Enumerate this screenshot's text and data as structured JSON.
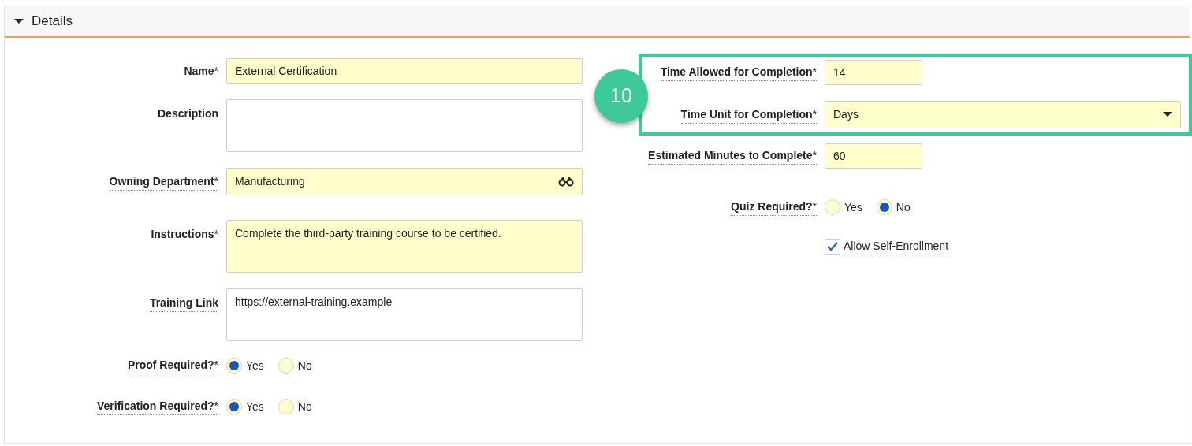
{
  "section": {
    "title": "Details",
    "expanded": true
  },
  "left_fields": [
    {
      "kind": "text",
      "label": "Name",
      "required_mark": "*",
      "required": true,
      "help": false,
      "value": "External Certification"
    },
    {
      "kind": "textarea",
      "label": "Description",
      "required": false,
      "help": false
    },
    {
      "kind": "lookup",
      "label": "Owning Department",
      "required_mark": "*",
      "required": true,
      "help": true,
      "value": "Manufacturing"
    },
    {
      "kind": "textarea",
      "label": "Instructions",
      "required_mark": "*",
      "required": true,
      "help": false,
      "value": "Complete the third-party training course to be certified."
    },
    {
      "kind": "textarea",
      "label": "Training Link",
      "required": false,
      "help": true,
      "value": "https://external-training.example"
    },
    {
      "kind": "radio",
      "label": "Proof Required?",
      "required_mark": "*",
      "required": true,
      "help": true,
      "options": [
        {
          "label": "Yes",
          "selected": true
        },
        {
          "label": "No",
          "selected": false
        }
      ]
    },
    {
      "kind": "radio",
      "label": "Verification Required?",
      "required_mark": "*",
      "required": true,
      "help": true,
      "options": [
        {
          "label": "Yes",
          "selected": true
        },
        {
          "label": "No",
          "selected": false
        }
      ]
    }
  ],
  "highlight": {
    "badge": "10",
    "fields": [
      {
        "kind": "short",
        "label": "Time Allowed for Completion",
        "required_mark": "*",
        "required": true,
        "help": true,
        "value": "14"
      },
      {
        "kind": "select",
        "label": "Time Unit for Completion",
        "required_mark": "*",
        "required": true,
        "help": true,
        "value": "Days"
      }
    ]
  },
  "right_fields": [
    {
      "kind": "short",
      "label": "Estimated Minutes to Complete",
      "required_mark": "*",
      "required": true,
      "help": true,
      "value": "60"
    },
    {
      "kind": "radio",
      "label": "Quiz Required?",
      "required_mark": "*",
      "required": true,
      "help": true,
      "options": [
        {
          "label": "Yes",
          "selected": false
        },
        {
          "label": "No",
          "selected": true
        }
      ]
    },
    {
      "kind": "checkbox",
      "label": "Allow Self-Enrollment",
      "checked": true,
      "help": true
    }
  ]
}
